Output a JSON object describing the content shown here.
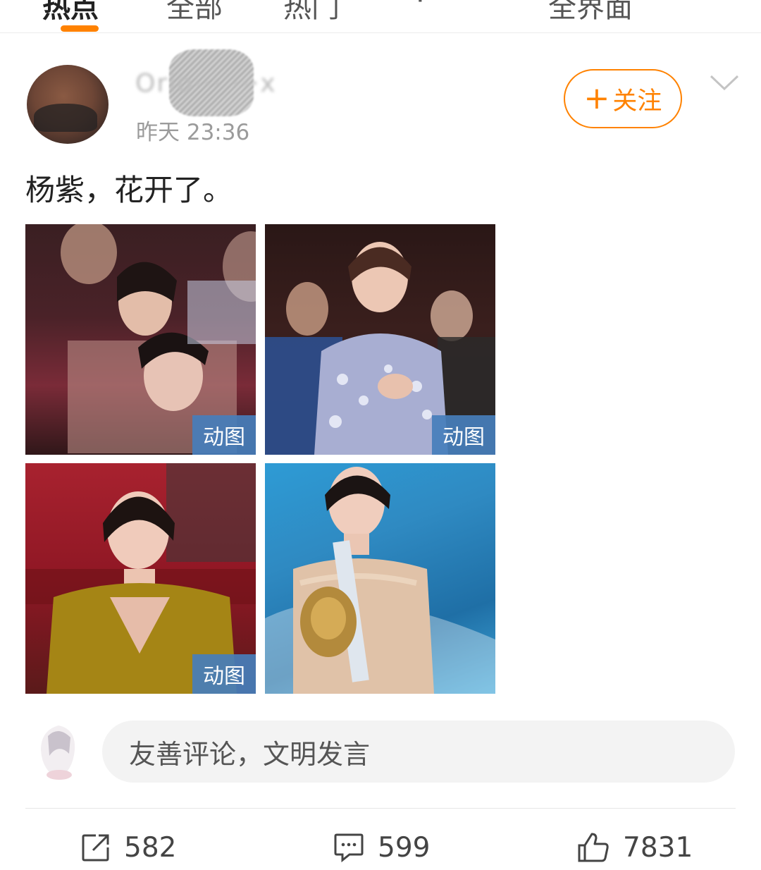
{
  "tabs": [
    {
      "label": "热点"
    },
    {
      "label": "全部"
    },
    {
      "label": "热门"
    },
    {
      "label": "·"
    },
    {
      "label": "全界面"
    }
  ],
  "post": {
    "username": "Orio··· ···x",
    "timestamp": "昨天 23:36",
    "follow_label": "关注",
    "text": "杨紫，花开了。",
    "images": [
      {
        "badge": "动图"
      },
      {
        "badge": "动图"
      },
      {
        "badge": "动图"
      },
      {
        "badge": ""
      }
    ]
  },
  "comment": {
    "placeholder": "友善评论，文明发言"
  },
  "actions": {
    "repost_count": "582",
    "comment_count": "599",
    "like_count": "7831"
  },
  "colors": {
    "accent": "#ff8200",
    "badge": "#477ebb"
  }
}
